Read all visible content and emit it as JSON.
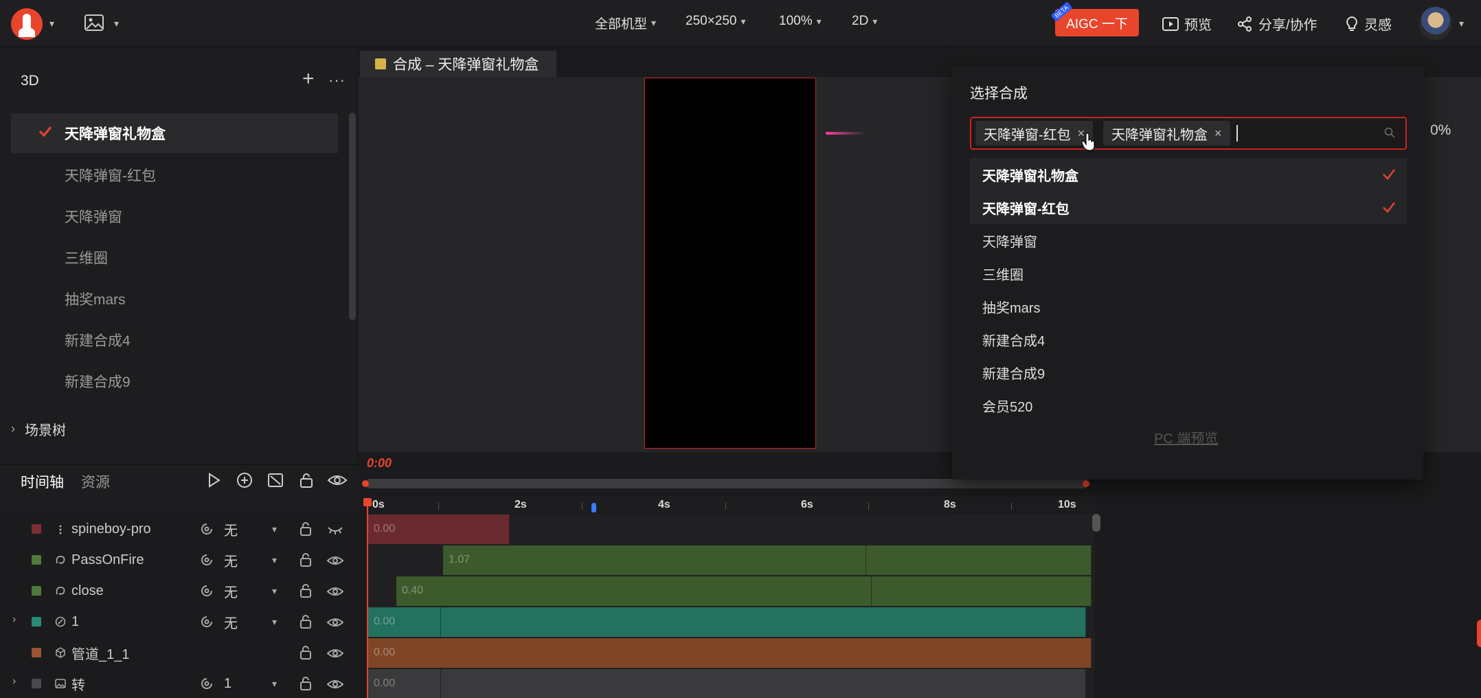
{
  "topbar": {
    "menus": [
      {
        "label": "全部机型"
      },
      {
        "label": "250×250"
      },
      {
        "label": "100%"
      },
      {
        "label": "2D"
      }
    ],
    "aigc": {
      "label": "AIGC 一下",
      "badge": "BETA"
    },
    "actions": [
      {
        "label": "预览",
        "icon": "play-box-icon"
      },
      {
        "label": "分享/协作",
        "icon": "share-icon"
      },
      {
        "label": "灵感",
        "icon": "bulb-icon"
      }
    ]
  },
  "left_panel": {
    "title": "3D",
    "compositions": [
      {
        "label": "天降弹窗礼物盒",
        "active": true
      },
      {
        "label": "天降弹窗-红包",
        "active": false
      },
      {
        "label": "天降弹窗",
        "active": false
      },
      {
        "label": "三维圈",
        "active": false
      },
      {
        "label": "抽奖mars",
        "active": false
      },
      {
        "label": "新建合成4",
        "active": false
      },
      {
        "label": "新建合成9",
        "active": false
      }
    ],
    "scene_tree": "场景树"
  },
  "timeline": {
    "tabs": [
      "时间轴",
      "资源"
    ],
    "current_time": "0:00",
    "ruler": [
      "0s",
      "2s",
      "4s",
      "6s",
      "8s",
      "10s"
    ],
    "tracks": [
      {
        "name": "spineboy-pro",
        "color": "#7a2f34",
        "mode": "无",
        "start": "0.00"
      },
      {
        "name": "PassOnFire",
        "color": "#4f7a3a",
        "mode": "无",
        "start": "1.07"
      },
      {
        "name": "close",
        "color": "#4f7a3a",
        "mode": "无",
        "start": "0.40"
      },
      {
        "name": "1",
        "color": "#2a8a78",
        "mode": "无",
        "start": "0.00"
      },
      {
        "name": "管道_1_1",
        "color": "#9a5530",
        "mode": "",
        "start": "0.00"
      },
      {
        "name": "转",
        "color": "#4a4a4c",
        "mode": "1",
        "start": "0.00"
      }
    ]
  },
  "canvas": {
    "tab_label": "合成 – 天降弹窗礼物盒"
  },
  "select_comp": {
    "title": "选择合成",
    "chips": [
      "天降弹窗-红包",
      "天降弹窗礼物盒"
    ],
    "options": [
      {
        "label": "天降弹窗礼物盒",
        "selected": true
      },
      {
        "label": "天降弹窗-红包",
        "selected": true
      },
      {
        "label": "天降弹窗",
        "selected": false
      },
      {
        "label": "三维圈",
        "selected": false
      },
      {
        "label": "抽奖mars",
        "selected": false
      },
      {
        "label": "新建合成4",
        "selected": false
      },
      {
        "label": "新建合成9",
        "selected": false
      },
      {
        "label": "会员520",
        "selected": false
      }
    ],
    "pc_preview": "PC 端预览",
    "percent_fragment": "0%"
  },
  "colors": {
    "accent": "#e8452c",
    "border_red": "#c8231f",
    "bg": "#1b1b1d"
  }
}
